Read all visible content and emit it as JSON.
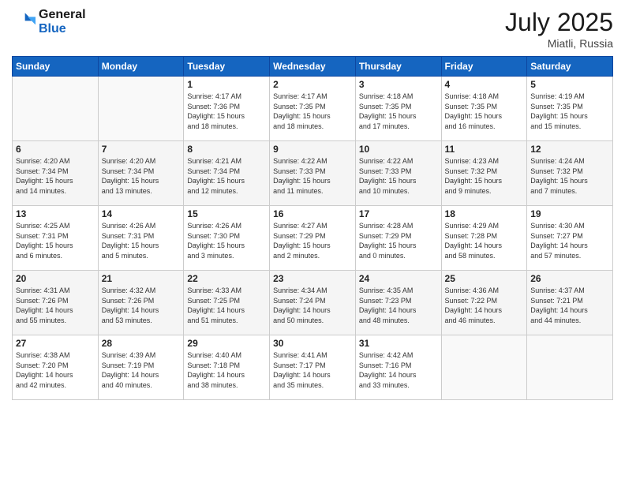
{
  "logo": {
    "line1": "General",
    "line2": "Blue"
  },
  "title": "July 2025",
  "location": "Miatli, Russia",
  "days_header": [
    "Sunday",
    "Monday",
    "Tuesday",
    "Wednesday",
    "Thursday",
    "Friday",
    "Saturday"
  ],
  "weeks": [
    [
      {
        "day": "",
        "info": ""
      },
      {
        "day": "",
        "info": ""
      },
      {
        "day": "1",
        "info": "Sunrise: 4:17 AM\nSunset: 7:36 PM\nDaylight: 15 hours\nand 18 minutes."
      },
      {
        "day": "2",
        "info": "Sunrise: 4:17 AM\nSunset: 7:35 PM\nDaylight: 15 hours\nand 18 minutes."
      },
      {
        "day": "3",
        "info": "Sunrise: 4:18 AM\nSunset: 7:35 PM\nDaylight: 15 hours\nand 17 minutes."
      },
      {
        "day": "4",
        "info": "Sunrise: 4:18 AM\nSunset: 7:35 PM\nDaylight: 15 hours\nand 16 minutes."
      },
      {
        "day": "5",
        "info": "Sunrise: 4:19 AM\nSunset: 7:35 PM\nDaylight: 15 hours\nand 15 minutes."
      }
    ],
    [
      {
        "day": "6",
        "info": "Sunrise: 4:20 AM\nSunset: 7:34 PM\nDaylight: 15 hours\nand 14 minutes."
      },
      {
        "day": "7",
        "info": "Sunrise: 4:20 AM\nSunset: 7:34 PM\nDaylight: 15 hours\nand 13 minutes."
      },
      {
        "day": "8",
        "info": "Sunrise: 4:21 AM\nSunset: 7:34 PM\nDaylight: 15 hours\nand 12 minutes."
      },
      {
        "day": "9",
        "info": "Sunrise: 4:22 AM\nSunset: 7:33 PM\nDaylight: 15 hours\nand 11 minutes."
      },
      {
        "day": "10",
        "info": "Sunrise: 4:22 AM\nSunset: 7:33 PM\nDaylight: 15 hours\nand 10 minutes."
      },
      {
        "day": "11",
        "info": "Sunrise: 4:23 AM\nSunset: 7:32 PM\nDaylight: 15 hours\nand 9 minutes."
      },
      {
        "day": "12",
        "info": "Sunrise: 4:24 AM\nSunset: 7:32 PM\nDaylight: 15 hours\nand 7 minutes."
      }
    ],
    [
      {
        "day": "13",
        "info": "Sunrise: 4:25 AM\nSunset: 7:31 PM\nDaylight: 15 hours\nand 6 minutes."
      },
      {
        "day": "14",
        "info": "Sunrise: 4:26 AM\nSunset: 7:31 PM\nDaylight: 15 hours\nand 5 minutes."
      },
      {
        "day": "15",
        "info": "Sunrise: 4:26 AM\nSunset: 7:30 PM\nDaylight: 15 hours\nand 3 minutes."
      },
      {
        "day": "16",
        "info": "Sunrise: 4:27 AM\nSunset: 7:29 PM\nDaylight: 15 hours\nand 2 minutes."
      },
      {
        "day": "17",
        "info": "Sunrise: 4:28 AM\nSunset: 7:29 PM\nDaylight: 15 hours\nand 0 minutes."
      },
      {
        "day": "18",
        "info": "Sunrise: 4:29 AM\nSunset: 7:28 PM\nDaylight: 14 hours\nand 58 minutes."
      },
      {
        "day": "19",
        "info": "Sunrise: 4:30 AM\nSunset: 7:27 PM\nDaylight: 14 hours\nand 57 minutes."
      }
    ],
    [
      {
        "day": "20",
        "info": "Sunrise: 4:31 AM\nSunset: 7:26 PM\nDaylight: 14 hours\nand 55 minutes."
      },
      {
        "day": "21",
        "info": "Sunrise: 4:32 AM\nSunset: 7:26 PM\nDaylight: 14 hours\nand 53 minutes."
      },
      {
        "day": "22",
        "info": "Sunrise: 4:33 AM\nSunset: 7:25 PM\nDaylight: 14 hours\nand 51 minutes."
      },
      {
        "day": "23",
        "info": "Sunrise: 4:34 AM\nSunset: 7:24 PM\nDaylight: 14 hours\nand 50 minutes."
      },
      {
        "day": "24",
        "info": "Sunrise: 4:35 AM\nSunset: 7:23 PM\nDaylight: 14 hours\nand 48 minutes."
      },
      {
        "day": "25",
        "info": "Sunrise: 4:36 AM\nSunset: 7:22 PM\nDaylight: 14 hours\nand 46 minutes."
      },
      {
        "day": "26",
        "info": "Sunrise: 4:37 AM\nSunset: 7:21 PM\nDaylight: 14 hours\nand 44 minutes."
      }
    ],
    [
      {
        "day": "27",
        "info": "Sunrise: 4:38 AM\nSunset: 7:20 PM\nDaylight: 14 hours\nand 42 minutes."
      },
      {
        "day": "28",
        "info": "Sunrise: 4:39 AM\nSunset: 7:19 PM\nDaylight: 14 hours\nand 40 minutes."
      },
      {
        "day": "29",
        "info": "Sunrise: 4:40 AM\nSunset: 7:18 PM\nDaylight: 14 hours\nand 38 minutes."
      },
      {
        "day": "30",
        "info": "Sunrise: 4:41 AM\nSunset: 7:17 PM\nDaylight: 14 hours\nand 35 minutes."
      },
      {
        "day": "31",
        "info": "Sunrise: 4:42 AM\nSunset: 7:16 PM\nDaylight: 14 hours\nand 33 minutes."
      },
      {
        "day": "",
        "info": ""
      },
      {
        "day": "",
        "info": ""
      }
    ]
  ]
}
